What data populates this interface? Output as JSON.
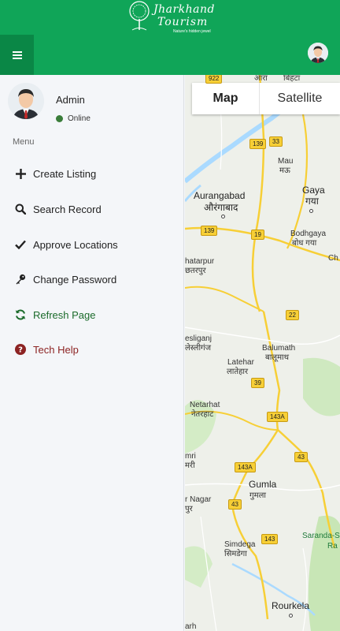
{
  "header": {
    "logo": {
      "line1": "Jharkhand",
      "line2": "Tourism",
      "tagline": "Nature's hidden jewel"
    }
  },
  "user": {
    "name": "Admin",
    "status": "Online"
  },
  "sidebar": {
    "menu_header": "Menu",
    "items": [
      {
        "label": "Create Listing",
        "icon": "plus-icon"
      },
      {
        "label": "Search Record",
        "icon": "search-icon"
      },
      {
        "label": "Approve Locations",
        "icon": "check-icon"
      },
      {
        "label": "Change Password",
        "icon": "key-icon"
      },
      {
        "label": "Refresh Page",
        "icon": "refresh-icon"
      },
      {
        "label": "Tech Help",
        "icon": "question-icon"
      }
    ]
  },
  "map": {
    "tabs": {
      "map": "Map",
      "satellite": "Satellite"
    },
    "cities": {
      "aurangabad_en": "Aurangabad",
      "aurangabad_hi": "औरंगाबाद",
      "gaya_en": "Gaya",
      "gaya_hi": "गया",
      "mau_en": "Mau",
      "mau_hi": "मऊ",
      "bodhgaya_en": "Bodhgaya",
      "bodhgaya_hi": "बोध गया",
      "chatarpur_en": "hatarpur",
      "chatarpur_hi": "छतरपुर",
      "lesliganj_en": "esliganj",
      "lesliganj_hi": "लेस्लीगंज",
      "balumath_en": "Balumath",
      "balumath_hi": "बालूमाथ",
      "latehar_en": "Latehar",
      "latehar_hi": "लातेहार",
      "netarhat_en": "Netarhat",
      "netarhat_hi": "नेतरहाट",
      "gumla_en": "Gumla",
      "gumla_hi": "गुमला",
      "simdega_en": "Simdega",
      "simdega_hi": "सिमडेगा",
      "rourkela_en": "Rourkela",
      "saranda_en": "Saranda-S",
      "mri_en": "mri",
      "mri_hi": "मरी",
      "nagar_en": "r Nagar",
      "nagar_hi": "पुर",
      "top1": "आरा",
      "top2": "बिहटा",
      "ranchi_edge": "Ch",
      "ra_edge": "Ra",
      "bottom_left": "arh"
    },
    "roads": [
      "922",
      "139",
      "33",
      "139",
      "19",
      "22",
      "39",
      "143A",
      "143A",
      "43",
      "43",
      "143"
    ],
    "colors": {
      "water": "#aadaff",
      "land": "#eef0ea",
      "forest": "#c8e6b6",
      "highway": "#f7cf36",
      "road": "#ffffff"
    }
  },
  "colors": {
    "brand_green": "#10a558",
    "dark_green": "#0a8746"
  }
}
